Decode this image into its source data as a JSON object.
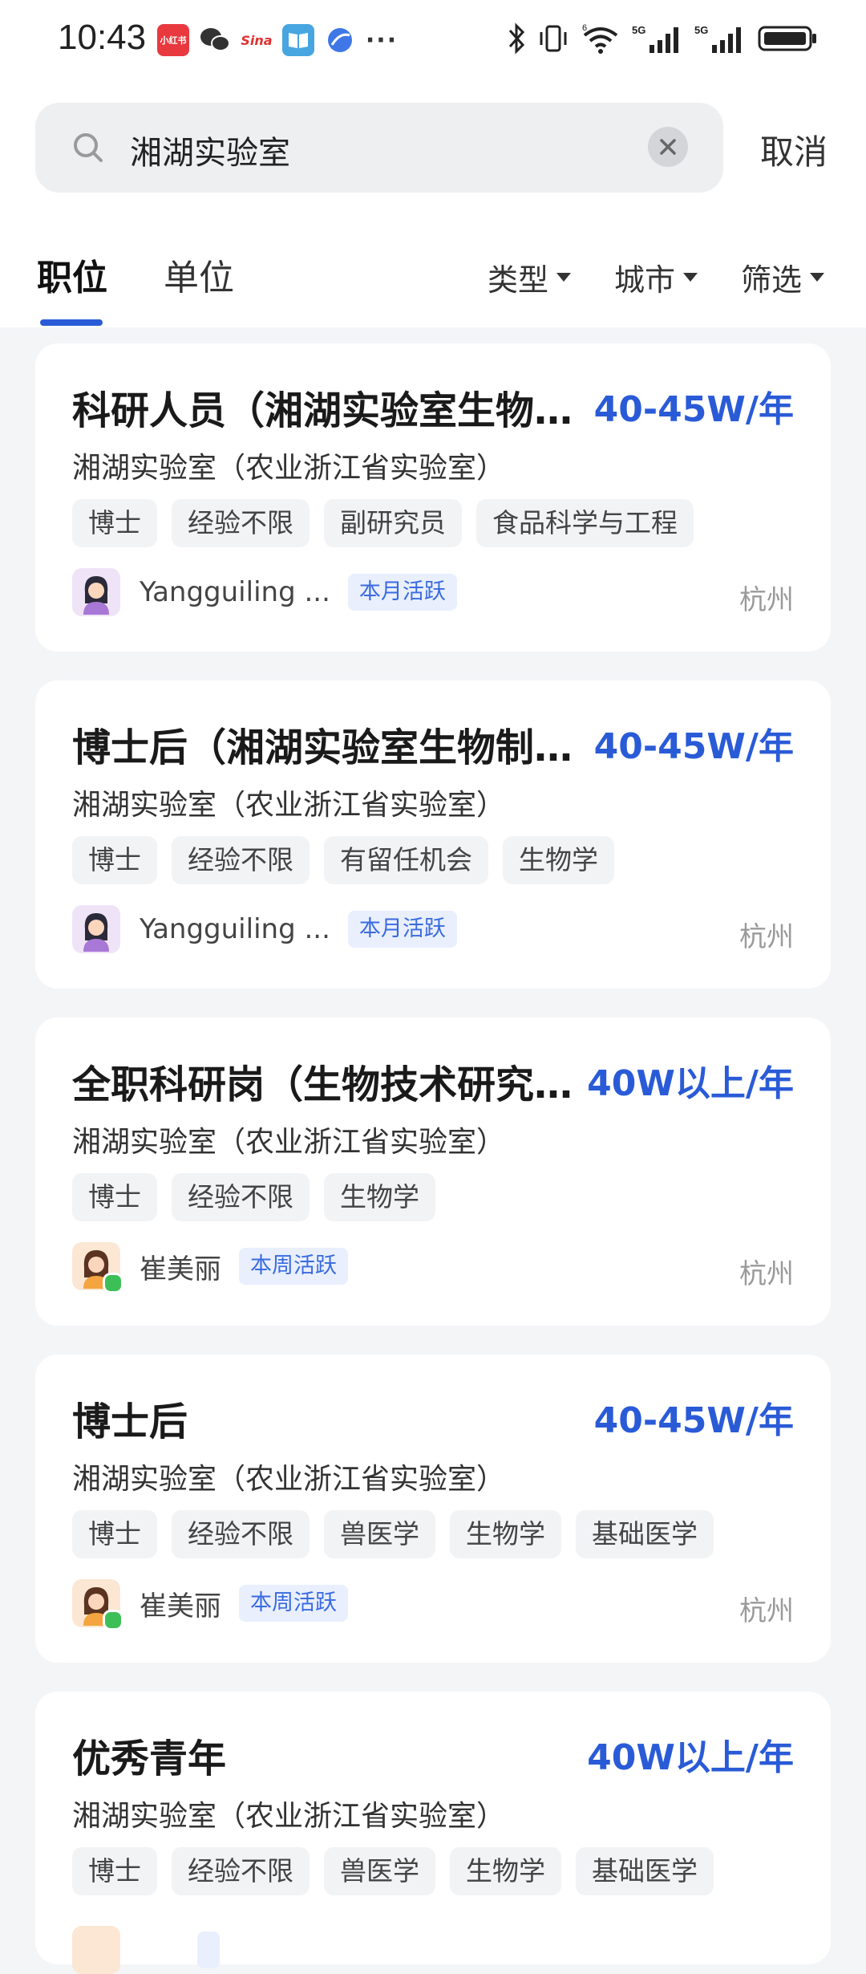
{
  "status_bar": {
    "time": "10:43",
    "notification_icons": [
      "xiaohongshu-icon",
      "wechat-icon",
      "sina-icon",
      "book-reader-icon",
      "browser-icon",
      "more-dots-icon"
    ],
    "xhs_label": "小红书",
    "sina_label": "Sina",
    "more": "···",
    "system_icons": [
      "bluetooth-icon",
      "vibrate-icon",
      "wifi-icon",
      "signal-5g-icon",
      "signal-5g-icon",
      "battery-icon"
    ],
    "network_5g": "5G",
    "wifi_badge": "6"
  },
  "search": {
    "query": "湘湖实验室",
    "cancel_label": "取消"
  },
  "tabs": [
    {
      "label": "职位",
      "active": true
    },
    {
      "label": "单位",
      "active": false
    }
  ],
  "filters": [
    {
      "label": "类型"
    },
    {
      "label": "城市"
    },
    {
      "label": "筛选"
    }
  ],
  "colors": {
    "accent": "#2a5bd7",
    "online": "#3dbf58"
  },
  "jobs": [
    {
      "title": "科研人员（湘湖实验室生物…",
      "salary": "40-45W/年",
      "company": "湘湖实验室（农业浙江省实验室）",
      "tags": [
        "博士",
        "经验不限",
        "副研究员",
        "食品科学与工程"
      ],
      "recruiter": "Yangguiling ...",
      "activity": "本月活跃",
      "city": "杭州"
    },
    {
      "title": "博士后（湘湖实验室生物制…",
      "salary": "40-45W/年",
      "company": "湘湖实验室（农业浙江省实验室）",
      "tags": [
        "博士",
        "经验不限",
        "有留任机会",
        "生物学"
      ],
      "recruiter": "Yangguiling ...",
      "activity": "本月活跃",
      "city": "杭州"
    },
    {
      "title": "全职科研岗（生物技术研究…",
      "salary": "40W以上/年",
      "company": "湘湖实验室（农业浙江省实验室）",
      "tags": [
        "博士",
        "经验不限",
        "生物学"
      ],
      "recruiter": "崔美丽",
      "activity": "本周活跃",
      "city": "杭州"
    },
    {
      "title": "博士后",
      "salary": "40-45W/年",
      "company": "湘湖实验室（农业浙江省实验室）",
      "tags": [
        "博士",
        "经验不限",
        "兽医学",
        "生物学",
        "基础医学"
      ],
      "recruiter": "崔美丽",
      "activity": "本周活跃",
      "city": "杭州"
    },
    {
      "title": "优秀青年",
      "salary": "40W以上/年",
      "company": "湘湖实验室（农业浙江省实验室）",
      "tags": [
        "博士",
        "经验不限",
        "兽医学",
        "生物学",
        "基础医学"
      ],
      "recruiter": "",
      "activity": "",
      "city": ""
    }
  ]
}
